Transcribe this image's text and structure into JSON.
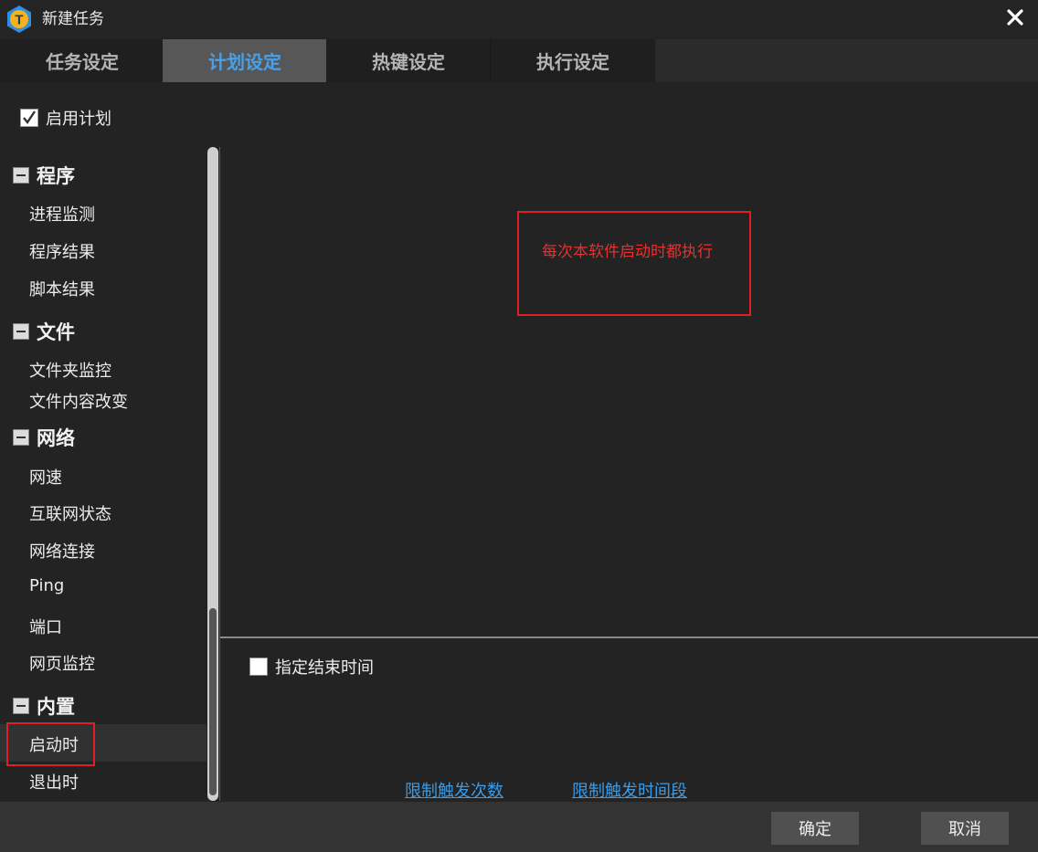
{
  "window": {
    "title": "新建任务",
    "logo_letter": "T"
  },
  "tabs": [
    {
      "label": "任务设定",
      "active": false
    },
    {
      "label": "计划设定",
      "active": true
    },
    {
      "label": "热键设定",
      "active": false
    },
    {
      "label": "执行设定",
      "active": false
    }
  ],
  "enable_plan": {
    "label": "启用计划",
    "checked": true
  },
  "tree": {
    "groups": [
      {
        "label": "程序",
        "items": [
          "进程监测",
          "程序结果",
          "脚本结果"
        ]
      },
      {
        "label": "文件",
        "items": [
          "文件夹监控",
          "文件内容改变"
        ]
      },
      {
        "label": "网络",
        "items": [
          "网速",
          "互联网状态",
          "网络连接",
          "Ping",
          "端口",
          "网页监控"
        ]
      },
      {
        "label": "内置",
        "items": [
          "启动时",
          "退出时"
        ]
      }
    ],
    "selected": "启动时"
  },
  "main": {
    "description": "每次本软件启动时都执行",
    "end_time": {
      "label": "指定结束时间",
      "checked": false
    },
    "links": {
      "limit_count": "限制触发次数",
      "limit_period": "限制触发时间段"
    }
  },
  "footer": {
    "ok": "确定",
    "cancel": "取消"
  },
  "colors": {
    "accent": "#4aa0e8",
    "highlight_red": "#e02020",
    "link": "#3a9be6"
  }
}
